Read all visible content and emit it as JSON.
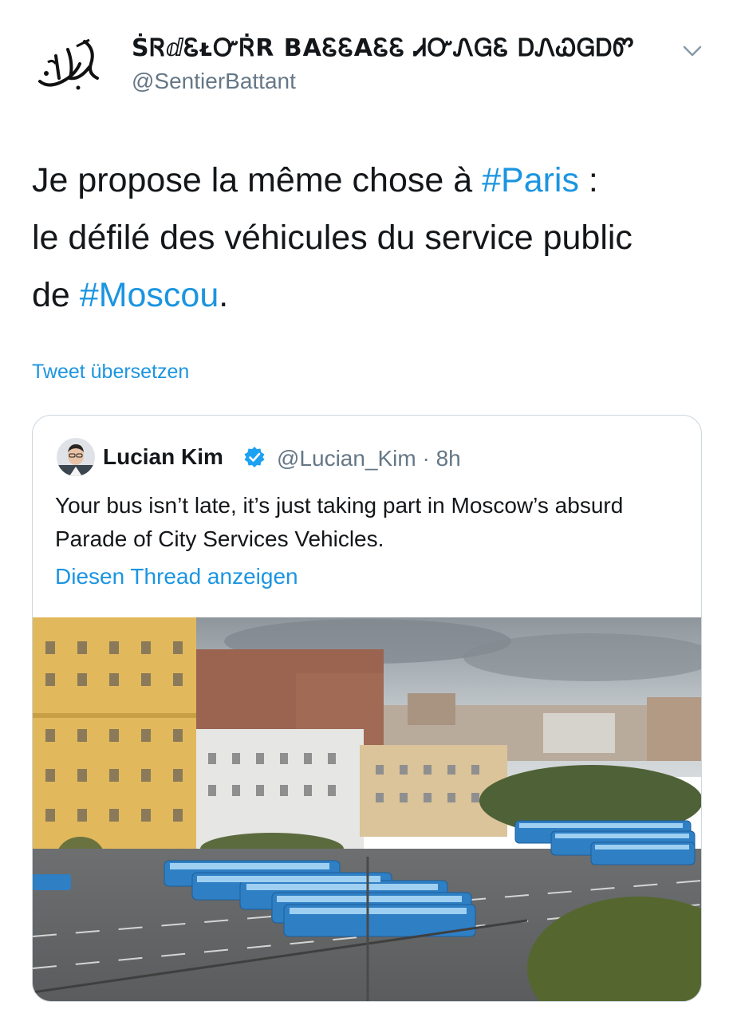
{
  "tweet": {
    "display_name": "ṠᏒⅆᏋᴌᏅᏒ̇R BAᏋᏋAᏋᏋ ᏗᏅᏁᏀᏋ ᎠᏁᏇᏀᎠᏛ",
    "handle": "@SentierBattant",
    "avatar_icon": "calligraphy-logo",
    "menu_icon": "chevron-down-icon",
    "text_parts": {
      "p1": "Je propose la même chose à ",
      "tag1": "#Paris",
      "p2": " :",
      "p3": "le défilé des véhicules du service public",
      "p4": "de ",
      "tag2": "#Moscou",
      "p5": "."
    },
    "translate_link": "Tweet übersetzen"
  },
  "quoted": {
    "name": "Lucian Kim",
    "handle_time": "@Lucian_Kim · 8h",
    "verified_icon": "verified-badge-icon",
    "text": "Your bus isn’t late, it’s just taking part in Moscow’s absurd Parade of City Services Vehicles.",
    "thread_link": "Diesen Thread anzeigen"
  },
  "colors": {
    "link": "#1b95e0",
    "secondary": "#657786",
    "border": "#ccd6dd"
  }
}
